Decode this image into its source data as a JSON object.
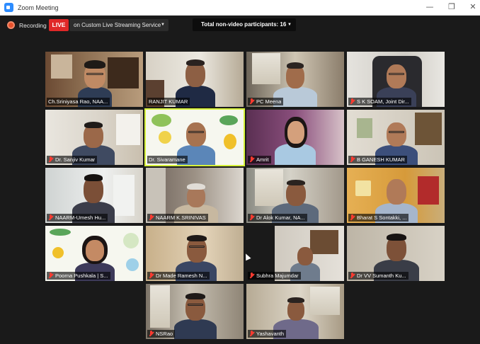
{
  "window": {
    "title": "Zoom Meeting",
    "minimize_glyph": "—",
    "maximize_glyph": "❐",
    "close_glyph": "✕"
  },
  "toolbar": {
    "recording_label": "Recording",
    "live_label": "LIVE",
    "stream_label": "on Custom Live Streaming Service",
    "non_video_label": "Total non-video participants: 16",
    "dropdown_glyph": "▼",
    "accent": "#e02828",
    "brand": "#2d8cff"
  },
  "participants": [
    {
      "name": "Ch.Sriniyasa Rao, NAA...",
      "muted": false
    },
    {
      "name": "RANJIT KUMAR",
      "muted": false
    },
    {
      "name": "PC Meena",
      "muted": true
    },
    {
      "name": "S K SOAM, Joint Dir...",
      "muted": true
    },
    {
      "name": "Dr. Sanjiv Kumar",
      "muted": true
    },
    {
      "name": "Dr. Sivaramane",
      "muted": false
    },
    {
      "name": "Amrit",
      "muted": true
    },
    {
      "name": "B GANESH KUMAR",
      "muted": true
    },
    {
      "name": "NAARM-Umesh Hu...",
      "muted": true
    },
    {
      "name": "NAARM K.SRINIVAS",
      "muted": true
    },
    {
      "name": "Dr Alok Kumar, NA...",
      "muted": true
    },
    {
      "name": "Bharat S Sontakki, ...",
      "muted": true
    },
    {
      "name": "Poorna Pushkala | S...",
      "muted": true
    },
    {
      "name": "Dr Made Ramesh N...",
      "muted": true
    },
    {
      "name": "Subhra Majumdar",
      "muted": true
    },
    {
      "name": "Dr VV Sumanth Ku...",
      "muted": true
    },
    {
      "name": "NSRao",
      "muted": true
    },
    {
      "name": "Yashavanth",
      "muted": true
    }
  ],
  "active_speaker": "Dr. Sivaramane"
}
